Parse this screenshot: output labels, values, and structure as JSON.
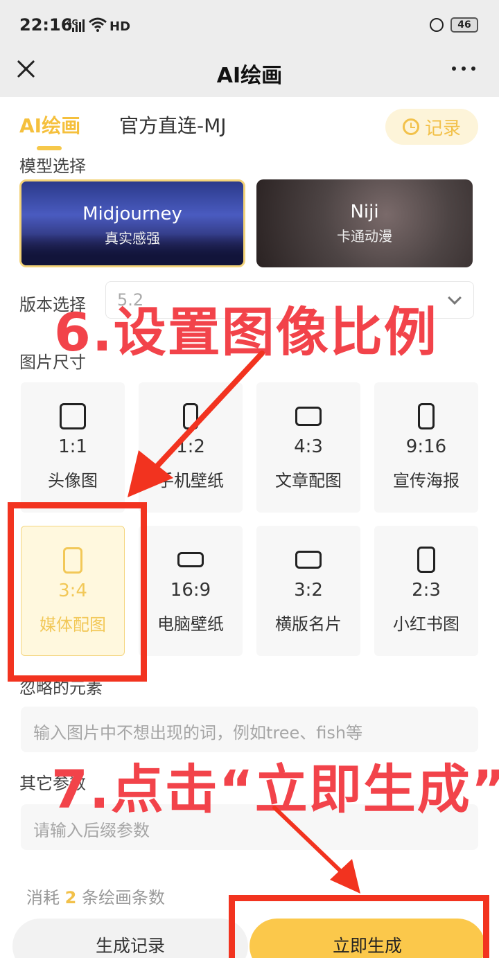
{
  "status_bar": {
    "time": "22:16",
    "network": "4G",
    "hd": "HD",
    "battery": "46"
  },
  "nav": {
    "title": "AI绘画"
  },
  "tabs": [
    {
      "label": "AI绘画"
    },
    {
      "label": "官方直连-MJ"
    }
  ],
  "record_button": {
    "label": "记录"
  },
  "model_section": {
    "label": "模型选择",
    "models": [
      {
        "name": "Midjourney",
        "sub": "真实感强",
        "selected": true
      },
      {
        "name": "Niji",
        "sub": "卡通动漫",
        "selected": false
      }
    ]
  },
  "version": {
    "label": "版本选择",
    "value": "5.2"
  },
  "size_section": {
    "label": "图片尺寸",
    "ratios": [
      {
        "ratio": "1:1",
        "name": "头像图",
        "selected": false
      },
      {
        "ratio": "1:2",
        "name": "手机壁纸",
        "selected": false
      },
      {
        "ratio": "4:3",
        "name": "文章配图",
        "selected": false
      },
      {
        "ratio": "9:16",
        "name": "宣传海报",
        "selected": false
      },
      {
        "ratio": "3:4",
        "name": "媒体配图",
        "selected": true
      },
      {
        "ratio": "16:9",
        "name": "电脑壁纸",
        "selected": false
      },
      {
        "ratio": "3:2",
        "name": "横版名片",
        "selected": false
      },
      {
        "ratio": "2:3",
        "name": "小红书图",
        "selected": false
      }
    ]
  },
  "ignore_section": {
    "label": "忽略的元素",
    "placeholder": "输入图片中不想出现的词，例如tree、fish等"
  },
  "params_section": {
    "label": "其它参数",
    "placeholder": "请输入后缀参数"
  },
  "consume": {
    "prefix": "消耗",
    "count": "2",
    "suffix": "条绘画条数"
  },
  "buttons": {
    "history": "生成记录",
    "generate": "立即生成"
  },
  "annotations": {
    "step6": "6.设置图像比例",
    "step7": "7.点击“立即生成”"
  },
  "colors": {
    "accent": "#f5c03d",
    "annotation": "#f2434a"
  }
}
